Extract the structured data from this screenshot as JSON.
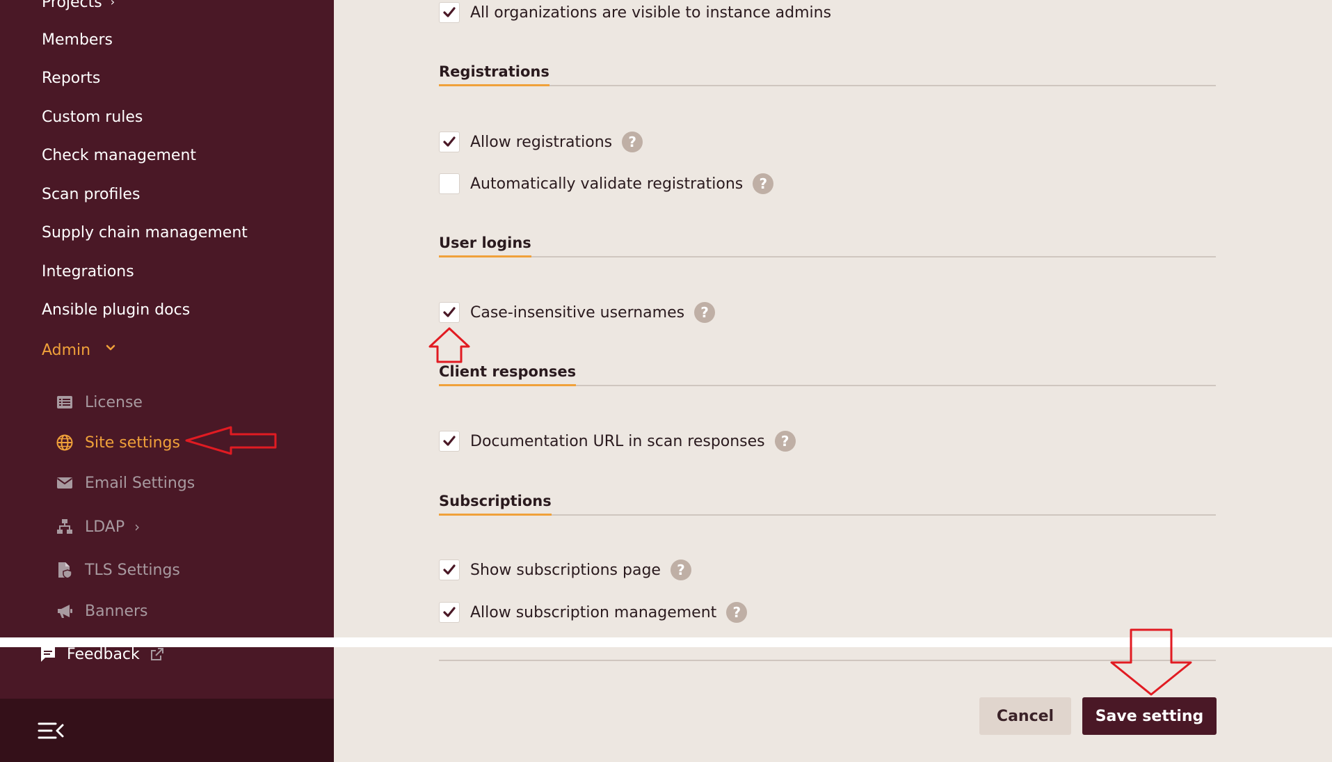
{
  "sidebar": {
    "items": [
      {
        "label": "Projects"
      },
      {
        "label": "Members"
      },
      {
        "label": "Reports"
      },
      {
        "label": "Custom rules"
      },
      {
        "label": "Check management"
      },
      {
        "label": "Scan profiles"
      },
      {
        "label": "Supply chain management"
      },
      {
        "label": "Integrations"
      },
      {
        "label": "Ansible plugin docs"
      },
      {
        "label": "Admin"
      }
    ],
    "admin_items": [
      {
        "label": "License",
        "icon": "list-icon"
      },
      {
        "label": "Site settings",
        "icon": "globe-icon"
      },
      {
        "label": "Email Settings",
        "icon": "envelope-icon"
      },
      {
        "label": "LDAP",
        "icon": "network-icon"
      },
      {
        "label": "TLS Settings",
        "icon": "file-shield-icon"
      },
      {
        "label": "Banners",
        "icon": "megaphone-icon"
      }
    ],
    "feedback_label": "Feedback"
  },
  "settings": {
    "org_visibility": {
      "label": "All organizations are visible to instance admins",
      "checked": true
    },
    "registrations": {
      "title": "Registrations",
      "allow": {
        "label": "Allow registrations",
        "checked": true
      },
      "auto_validate": {
        "label": "Automatically validate registrations",
        "checked": false
      }
    },
    "user_logins": {
      "title": "User logins",
      "case_insensitive": {
        "label": "Case-insensitive usernames",
        "checked": true
      }
    },
    "client_responses": {
      "title": "Client responses",
      "doc_url": {
        "label": "Documentation URL in scan responses",
        "checked": true
      }
    },
    "subscriptions": {
      "title": "Subscriptions",
      "show_page": {
        "label": "Show subscriptions page",
        "checked": true
      },
      "allow_management": {
        "label": "Allow subscription management",
        "checked": true
      }
    },
    "help_glyph": "?"
  },
  "footer": {
    "cancel_label": "Cancel",
    "save_label": "Save setting"
  },
  "colors": {
    "sidebar_bg": "#4a1826",
    "sidebar_bottom": "#341019",
    "accent": "#f0a13a",
    "main_bg": "#ede7e1",
    "primary_button": "#4a1826",
    "annotation_red": "#e11b22"
  }
}
